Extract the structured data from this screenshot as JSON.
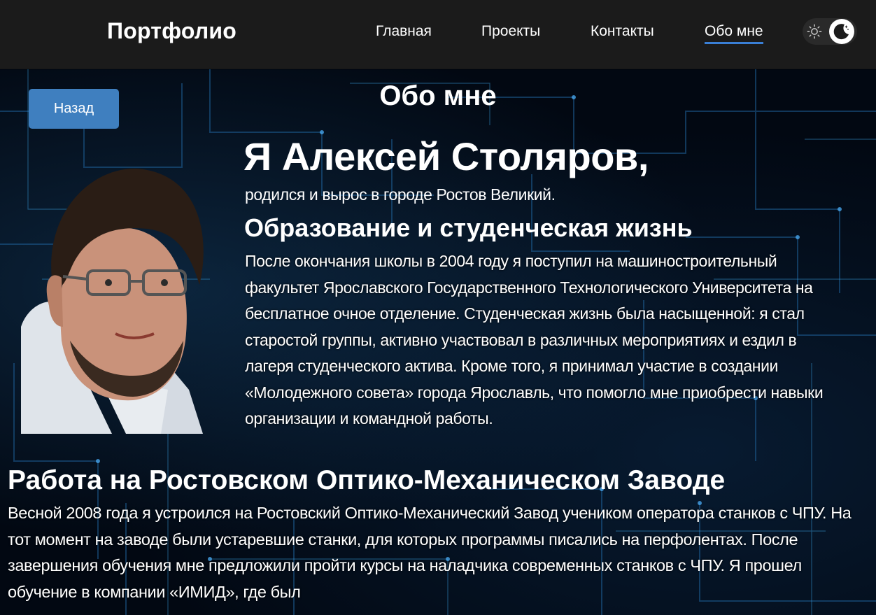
{
  "header": {
    "brand": "Портфолио",
    "nav": [
      {
        "label": "Главная"
      },
      {
        "label": "Проекты"
      },
      {
        "label": "Контакты"
      },
      {
        "label": "Обо мне",
        "active": true
      }
    ],
    "theme_toggle": {
      "sun_icon": "sun-icon",
      "moon_icon": "moon-icon",
      "mode": "dark"
    }
  },
  "main": {
    "back_label": "Назад",
    "page_title": "Обо мне",
    "photo": {
      "icon": "portrait-photo"
    },
    "hero_name": "Я Алексей Столяров,",
    "hero_sub": "родился и вырос в городе Ростов Великий.",
    "education": {
      "heading": "Образование и студенческая жизнь",
      "text": "После окончания школы в 2004 году я поступил на машиностроительный факультет Ярославского Государственного Технологического Университета на бесплатное очное отделение. Студенческая жизнь была насыщенной: я стал старостой группы, активно участвовал в различных мероприятиях и ездил в лагеря студенческого актива. Кроме того, я принимал участие в создании «Молодежного совета» города Ярославль, что помогло мне приобрести навыки организации и командной работы."
    },
    "work": {
      "heading": "Работа на Ростовском Оптико-Механическом Заводе",
      "text": "Весной 2008 года я устроился на Ростовский Оптико-Механический Завод учеником оператора станков с ЧПУ. На тот момент на заводе были устаревшие станки, для которых программы писались на перфолентах. После завершения обучения мне предложили пройти курсы на наладчика современных станков с ЧПУ. Я прошел обучение в компании «ИМИД», где был"
    }
  },
  "colors": {
    "navbar_bg": "#1b1b1b",
    "accent": "#3a7fd5",
    "button_bg": "#3f7fbf",
    "text": "#ffffff"
  }
}
